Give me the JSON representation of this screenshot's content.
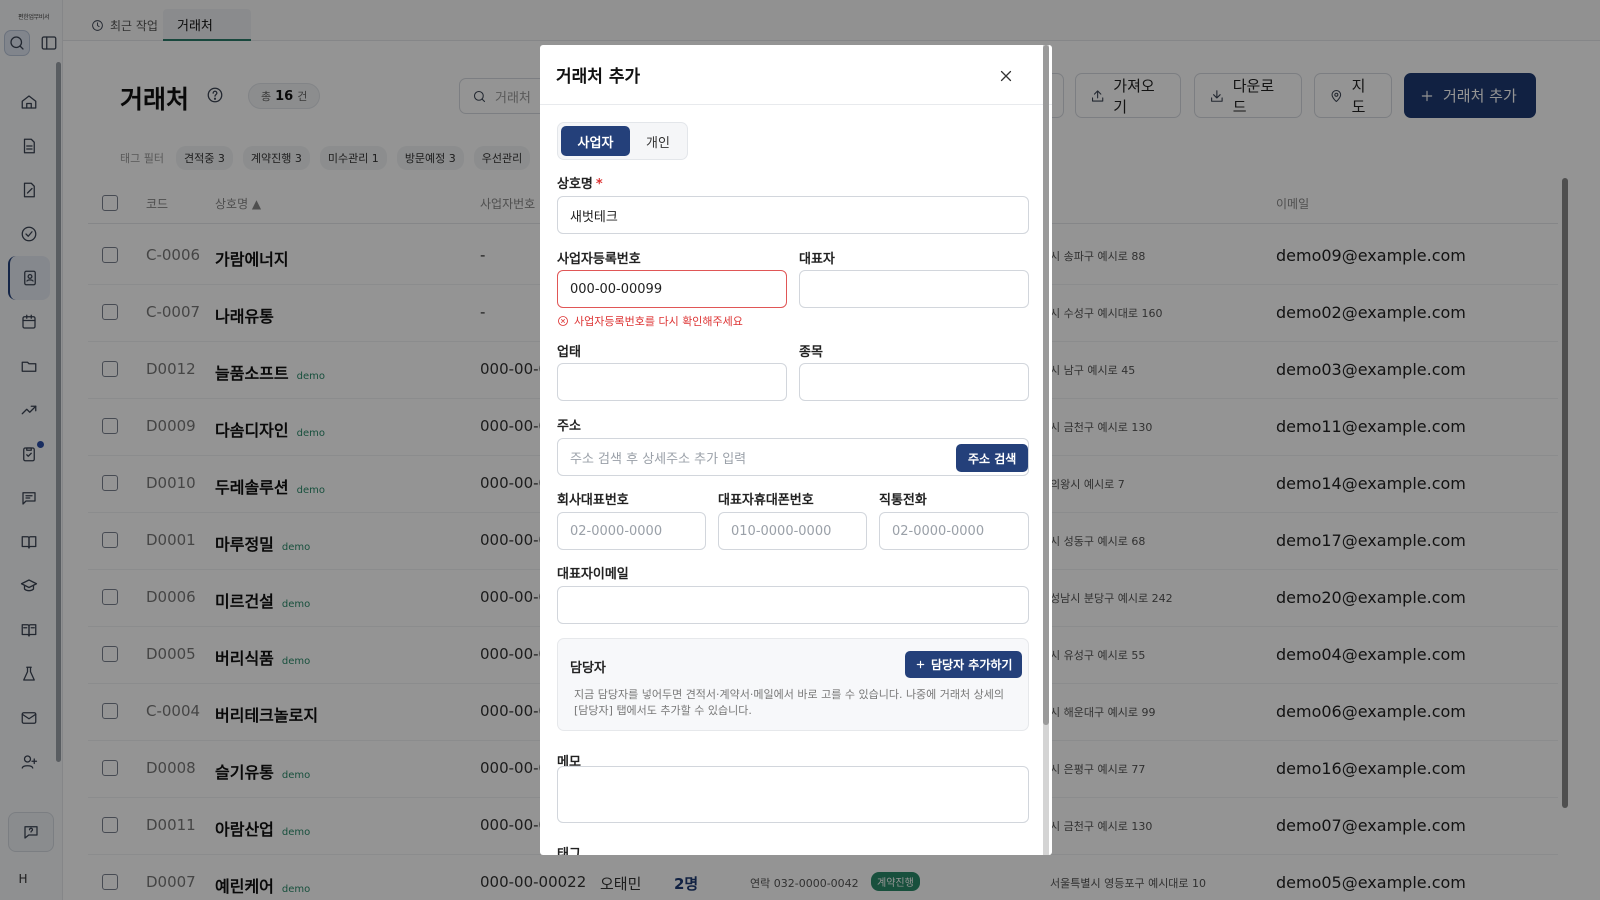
{
  "sidebar": {
    "brand": "편한업무비서",
    "avatar": "H"
  },
  "tabs": {
    "recent": "최근 작업",
    "current": "거래처"
  },
  "page": {
    "title": "거래처",
    "count_prefix": "총",
    "count": "16",
    "count_suffix": "건",
    "search_placeholder": "거래처",
    "import_label": "가져오기",
    "download_label": "다운로드",
    "map_label": "지도",
    "add_label": "거래처 추가"
  },
  "tag_filter": {
    "label": "태그 필터",
    "chips": [
      "견적중 3",
      "계약진행 3",
      "미수관리 1",
      "방문예정 3",
      "우선관리"
    ]
  },
  "table": {
    "headers": {
      "code": "코드",
      "name": "상호명 ▲",
      "biz": "사업자번호",
      "email": "이메일"
    },
    "rows": [
      {
        "code": "C-0006",
        "name": "가람에너지",
        "demo": "",
        "biz": "-",
        "addr": "시 송파구 예시로 88",
        "email": "demo09@example.com"
      },
      {
        "code": "C-0007",
        "name": "나래유통",
        "demo": "",
        "biz": "-",
        "addr": "시 수성구 예시대로 160",
        "email": "demo02@example.com"
      },
      {
        "code": "D0012",
        "name": "늘품소프트",
        "demo": "demo",
        "biz": "000-00-0",
        "addr": "시 남구 예시로 45",
        "email": "demo03@example.com"
      },
      {
        "code": "D0009",
        "name": "다솜디자인",
        "demo": "demo",
        "biz": "000-00-0",
        "addr": "시 금천구 예시로 130",
        "email": "demo11@example.com"
      },
      {
        "code": "D0010",
        "name": "두레솔루션",
        "demo": "demo",
        "biz": "000-00-0",
        "addr": "의왕시 예시로 7",
        "email": "demo14@example.com"
      },
      {
        "code": "D0001",
        "name": "마루정밀",
        "demo": "demo",
        "biz": "000-00-0",
        "addr": "시 성동구 예시로 68",
        "email": "demo17@example.com"
      },
      {
        "code": "D0006",
        "name": "미르건설",
        "demo": "demo",
        "biz": "000-00-0",
        "addr": "성남시 분당구 예시로 242",
        "email": "demo20@example.com"
      },
      {
        "code": "D0005",
        "name": "버리식품",
        "demo": "demo",
        "biz": "000-00-0",
        "addr": "시 유성구 예시로 55",
        "email": "demo04@example.com"
      },
      {
        "code": "C-0004",
        "name": "버리테크놀로지",
        "demo": "",
        "biz": "000-00-0",
        "addr": "시 해운대구 예시로 99",
        "email": "demo06@example.com"
      },
      {
        "code": "D0008",
        "name": "슬기유통",
        "demo": "demo",
        "biz": "000-00-0",
        "addr": "시 은평구 예시로 77",
        "email": "demo16@example.com"
      },
      {
        "code": "D0011",
        "name": "아람산업",
        "demo": "demo",
        "biz": "000-00-0",
        "addr": "시 금천구 예시로 130",
        "email": "demo07@example.com"
      },
      {
        "code": "D0007",
        "name": "예린케어",
        "demo": "demo",
        "biz": "000-00-00022",
        "addr": "서울특별시 영등포구 예시대로 10",
        "email": "demo05@example.com",
        "rep": "오태민",
        "cnt": "2명",
        "contact": "연락 032-0000-0042",
        "status": "계약진행"
      }
    ]
  },
  "modal": {
    "title": "거래처 추가",
    "seg_business": "사업자",
    "seg_individual": "개인",
    "company_label": "상호명",
    "required_mark": "*",
    "company_value": "새벗테크",
    "bizno_label": "사업자등록번호",
    "bizno_value": "000-00-00099",
    "bizno_error": "사업자등록번호를 다시 확인해주세요",
    "ceo_label": "대표자",
    "biztype_label": "업태",
    "item_label": "종목",
    "address_label": "주소",
    "address_placeholder": "주소 검색 후 상세주소 추가 입력",
    "address_search_btn": "주소 검색",
    "phone_label": "회사대표번호",
    "phone_placeholder": "02-0000-0000",
    "mobile_label": "대표자휴대폰번호",
    "mobile_placeholder": "010-0000-0000",
    "direct_label": "직통전화",
    "direct_placeholder": "02-0000-0000",
    "ceo_email_label": "대표자이메일",
    "contact_title": "담당자",
    "contact_add_btn": "담당자 추가하기",
    "contact_hint": "지금 담당자를 넣어두면 견적서·계약서·메일에서 바로 고를 수 있습니다. 나중에 거래처 상세의 [담당자] 탭에서도 추가할 수 있습니다.",
    "memo_label": "메모",
    "tag_label": "태그"
  }
}
